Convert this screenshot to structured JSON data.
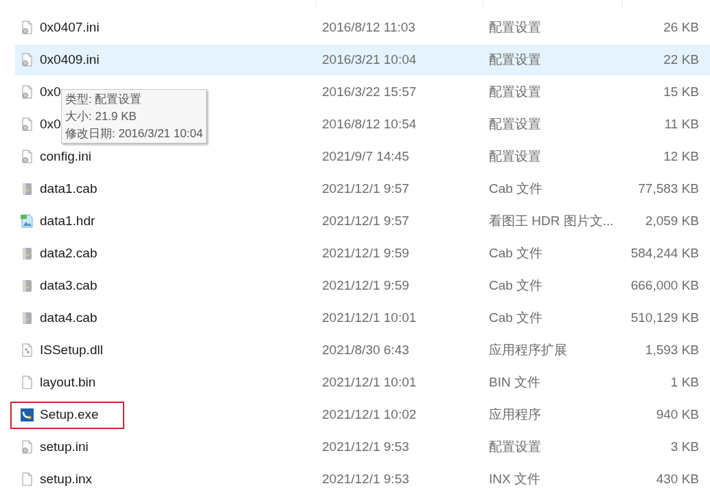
{
  "files": [
    {
      "name": "0x0407.ini",
      "date": "2016/8/12 11:03",
      "type": "配置设置",
      "size": "26 KB",
      "kind": "settings-file",
      "selected": false,
      "highlighted": false
    },
    {
      "name": "0x0409.ini",
      "date": "2016/3/21 10:04",
      "type": "配置设置",
      "size": "22 KB",
      "kind": "settings-file",
      "selected": true,
      "highlighted": false
    },
    {
      "name": "0x0",
      "date": "2016/3/22 15:57",
      "type": "配置设置",
      "size": "15 KB",
      "kind": "settings-file",
      "selected": false,
      "highlighted": false
    },
    {
      "name": "0x0",
      "date": "2016/8/12 10:54",
      "type": "配置设置",
      "size": "11 KB",
      "kind": "settings-file",
      "selected": false,
      "highlighted": false
    },
    {
      "name": "config.ini",
      "date": "2021/9/7 14:45",
      "type": "配置设置",
      "size": "12 KB",
      "kind": "settings-file",
      "selected": false,
      "highlighted": false
    },
    {
      "name": "data1.cab",
      "date": "2021/12/1 9:57",
      "type": "Cab 文件",
      "size": "77,583 KB",
      "kind": "cab",
      "selected": false,
      "highlighted": false
    },
    {
      "name": "data1.hdr",
      "date": "2021/12/1 9:57",
      "type": "看图王 HDR 图片文...",
      "size": "2,059 KB",
      "kind": "image",
      "selected": false,
      "highlighted": false
    },
    {
      "name": "data2.cab",
      "date": "2021/12/1 9:59",
      "type": "Cab 文件",
      "size": "584,244 KB",
      "kind": "cab",
      "selected": false,
      "highlighted": false
    },
    {
      "name": "data3.cab",
      "date": "2021/12/1 9:59",
      "type": "Cab 文件",
      "size": "666,000 KB",
      "kind": "cab",
      "selected": false,
      "highlighted": false
    },
    {
      "name": "data4.cab",
      "date": "2021/12/1 10:01",
      "type": "Cab 文件",
      "size": "510,129 KB",
      "kind": "cab",
      "selected": false,
      "highlighted": false
    },
    {
      "name": "ISSetup.dll",
      "date": "2021/8/30 6:43",
      "type": "应用程序扩展",
      "size": "1,593 KB",
      "kind": "dll",
      "selected": false,
      "highlighted": false
    },
    {
      "name": "layout.bin",
      "date": "2021/12/1 10:01",
      "type": "BIN 文件",
      "size": "1 KB",
      "kind": "blank",
      "selected": false,
      "highlighted": false
    },
    {
      "name": "Setup.exe",
      "date": "2021/12/1 10:02",
      "type": "应用程序",
      "size": "940 KB",
      "kind": "exe",
      "selected": false,
      "highlighted": true
    },
    {
      "name": "setup.ini",
      "date": "2021/12/1 9:53",
      "type": "配置设置",
      "size": "3 KB",
      "kind": "settings-file",
      "selected": false,
      "highlighted": false
    },
    {
      "name": "setup.inx",
      "date": "2021/12/1 9:53",
      "type": "INX 文件",
      "size": "430 KB",
      "kind": "blank",
      "selected": false,
      "highlighted": false
    }
  ],
  "tooltip": {
    "lines": [
      "类型: 配置设置",
      "大小: 21.9 KB",
      "修改日期: 2016/3/21 10:04"
    ]
  }
}
